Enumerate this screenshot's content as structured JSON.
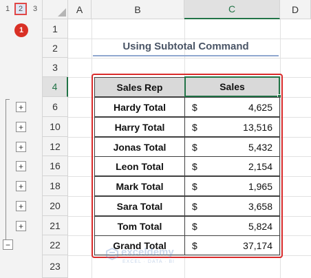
{
  "outline": {
    "levels": [
      "1",
      "2",
      "3"
    ],
    "callout": "1",
    "expand_symbol": "+",
    "collapse_symbol": "−"
  },
  "columns": [
    "A",
    "B",
    "C",
    "D"
  ],
  "rows": [
    "1",
    "2",
    "3",
    "4",
    "6",
    "10",
    "12",
    "16",
    "18",
    "20",
    "21",
    "22",
    "23"
  ],
  "title": "Using Subtotal Command",
  "table": {
    "headers": [
      "Sales Rep",
      "Sales"
    ],
    "currency_symbol": "$",
    "rows": [
      {
        "rep": "Hardy Total",
        "sales": "4,625"
      },
      {
        "rep": "Harry Total",
        "sales": "13,516"
      },
      {
        "rep": "Jonas Total",
        "sales": "5,432"
      },
      {
        "rep": "Leon Total",
        "sales": "2,154"
      },
      {
        "rep": "Mark Total",
        "sales": "1,965"
      },
      {
        "rep": "Sara Total",
        "sales": "3,658"
      },
      {
        "rep": "Tom Total",
        "sales": "5,824"
      },
      {
        "rep": "Grand Total",
        "sales": "37,174"
      }
    ]
  },
  "watermark": {
    "name": "exceldemy",
    "tagline": "EXCEL · DATA · BI"
  },
  "colors": {
    "accent_green": "#217346",
    "highlight_red": "#d92a2a",
    "title_underline": "#8fa7cf"
  }
}
